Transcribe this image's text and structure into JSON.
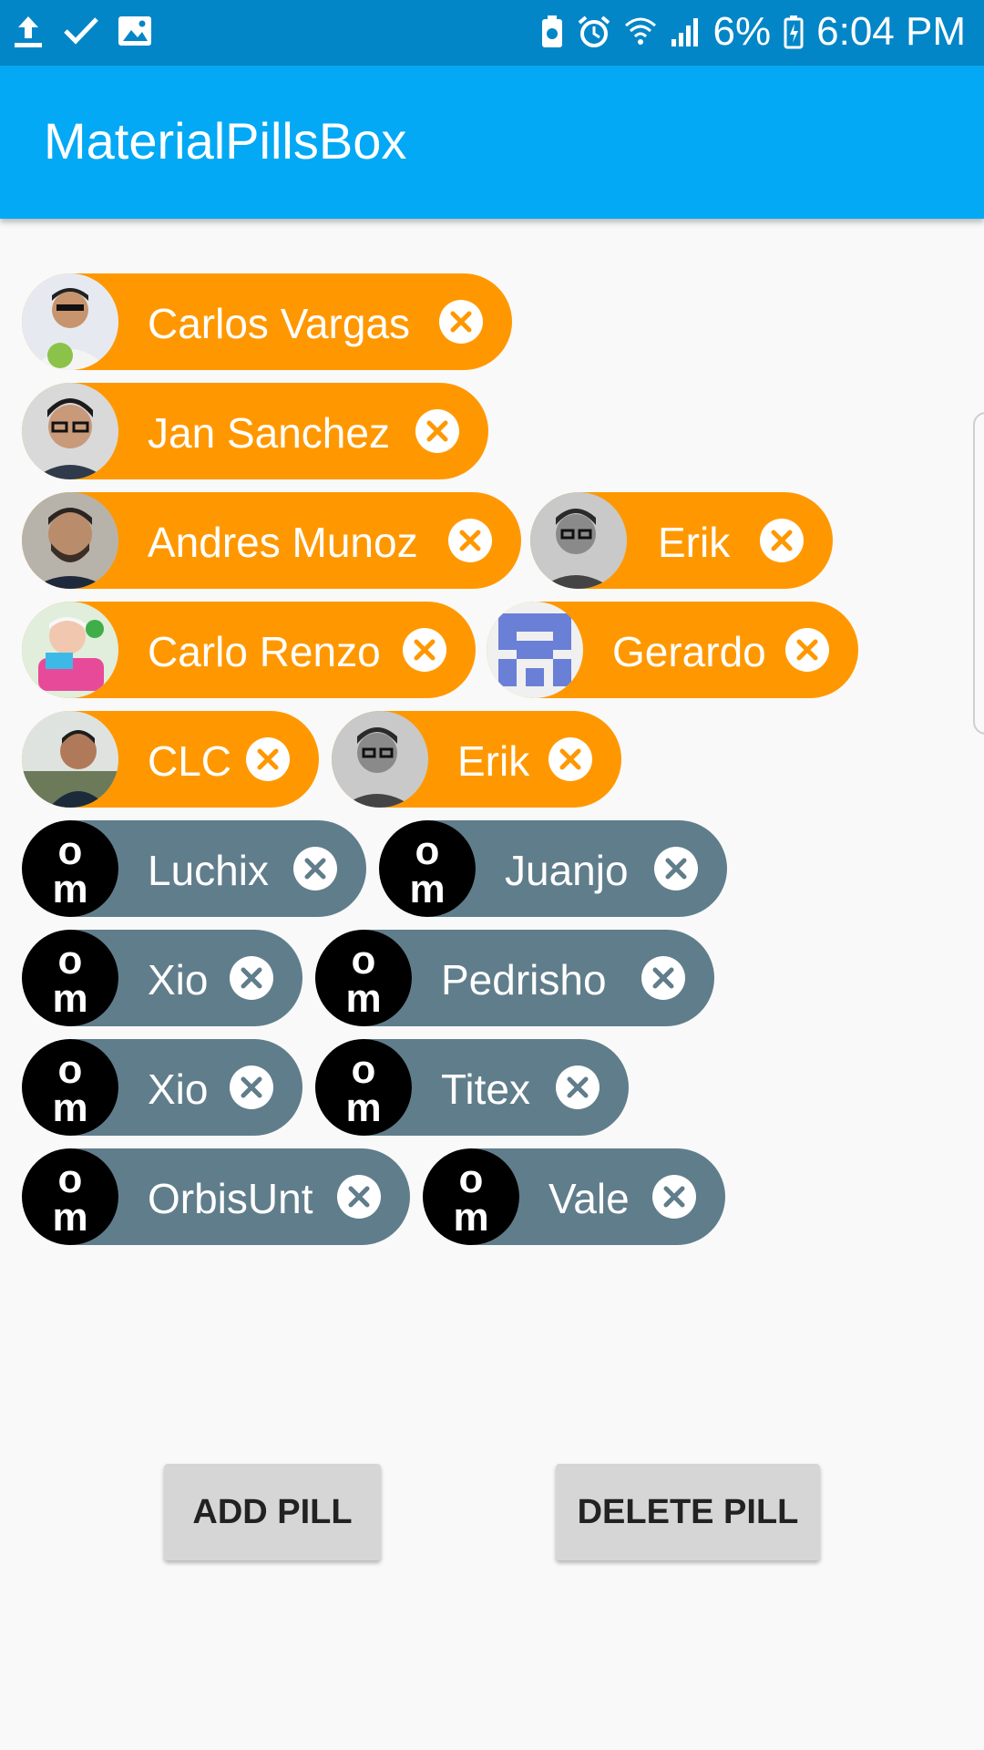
{
  "status_bar": {
    "battery": "6%",
    "time": "6:04 PM",
    "icons": [
      "upload-icon",
      "check-icon",
      "image-icon",
      "battery-saver-icon",
      "alarm-icon",
      "wifi-icon",
      "signal-icon",
      "battery-icon"
    ]
  },
  "app_bar": {
    "title": "MaterialPillsBox"
  },
  "pills": [
    {
      "label": "Carlos Vargas",
      "avatar": "photo"
    },
    {
      "label": "Jan Sanchez",
      "avatar": "photo"
    },
    {
      "label": "Andres Munoz",
      "avatar": "photo"
    },
    {
      "label": "Erik",
      "avatar": "photo"
    },
    {
      "label": "Carlo Renzo",
      "avatar": "photo"
    },
    {
      "label": "Gerardo",
      "avatar": "identicon"
    },
    {
      "label": "CLC",
      "avatar": "photo"
    },
    {
      "label": "Erik",
      "avatar": "photo"
    },
    {
      "label": "Luchix",
      "avatar": "om-logo"
    },
    {
      "label": "Juanjo",
      "avatar": "om-logo"
    },
    {
      "label": "Xio",
      "avatar": "om-logo"
    },
    {
      "label": "Pedrisho",
      "avatar": "om-logo"
    },
    {
      "label": "Xio",
      "avatar": "om-logo"
    },
    {
      "label": "Titex",
      "avatar": "om-logo"
    },
    {
      "label": "OrbisUnt",
      "avatar": "om-logo"
    },
    {
      "label": "Vale",
      "avatar": "om-logo"
    }
  ],
  "colors": {
    "status_bar": "#0386c7",
    "app_bar": "#03a9f4",
    "pill_primary": "#ff9800",
    "pill_secondary": "#607d8b"
  },
  "buttons": {
    "add": "ADD PILL",
    "delete": "DELETE PILL"
  }
}
